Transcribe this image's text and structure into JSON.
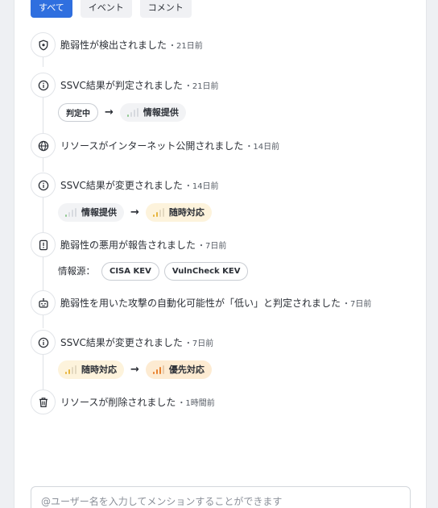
{
  "tabs": [
    {
      "label": "すべて",
      "active": true
    },
    {
      "label": "イベント",
      "active": false
    },
    {
      "label": "コメント",
      "active": false
    }
  ],
  "events": [
    {
      "icon": "shield-icon",
      "text": "脆弱性が検出されました",
      "time": "・21日前"
    },
    {
      "icon": "info-icon",
      "text": "SSVC結果が判定されました",
      "time": "・21日前",
      "detail": {
        "from": "判定中",
        "to": "情報提供"
      }
    },
    {
      "icon": "globe-icon",
      "text": "リソースがインターネット公開されました",
      "time": "・14日前"
    },
    {
      "icon": "info-icon",
      "text": "SSVC結果が変更されました",
      "time": "・14日前",
      "detail": {
        "from": "情報提供",
        "to": "随時対応"
      }
    },
    {
      "icon": "exclamation-file-icon",
      "text": "脆弱性の悪用が報告されました",
      "time": "・7日前",
      "sources": {
        "label": "情報源：",
        "items": [
          "CISA KEV",
          "VulnCheck KEV"
        ]
      }
    },
    {
      "icon": "robot-icon",
      "text": "脆弱性を用いた攻撃の自動化可能性が「低い」と判定されました",
      "time": "・7日前"
    },
    {
      "icon": "info-icon",
      "text": "SSVC結果が変更されました",
      "time": "・7日前",
      "detail": {
        "from": "随時対応",
        "to": "優先対応"
      }
    },
    {
      "icon": "trash-icon",
      "text": "リソースが削除されました",
      "time": "・1時間前"
    }
  ],
  "arrow": "→",
  "levels": {
    "info": {
      "color": "#8fc98f"
    },
    "adhoc": {
      "color": "#e6b43c"
    },
    "priority": {
      "color": "#e8812f"
    }
  },
  "mention_input": {
    "placeholder": "@ユーザー名を入力してメンションすることができます"
  }
}
